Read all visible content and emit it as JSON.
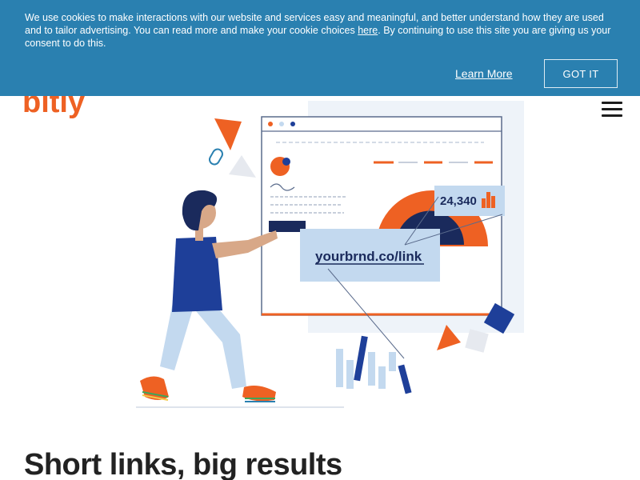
{
  "cookie_banner": {
    "text_before_link": "We use cookies to make interactions with our website and services easy and meaningful, and better understand how they are used and to tailor advertising. You can read more and make your cookie choices ",
    "link_text": "here",
    "text_after_link": ". By continuing to use this site you are giving us your consent to do this.",
    "learn_more_label": "Learn More",
    "got_it_label": "GOT IT",
    "background_color": "#2a80b0"
  },
  "header": {
    "logo_text": "bitly",
    "logo_color": "#ee6123",
    "menu_icon": "hamburger-menu-icon"
  },
  "hero": {
    "illustration": {
      "stat_value": "24,340",
      "short_link": "yourbrnd.co/link"
    },
    "headline": "Short links, big results"
  },
  "colors": {
    "accent_orange": "#ee6123",
    "navy": "#1e3f99",
    "light_blue": "#c3d9ef"
  }
}
